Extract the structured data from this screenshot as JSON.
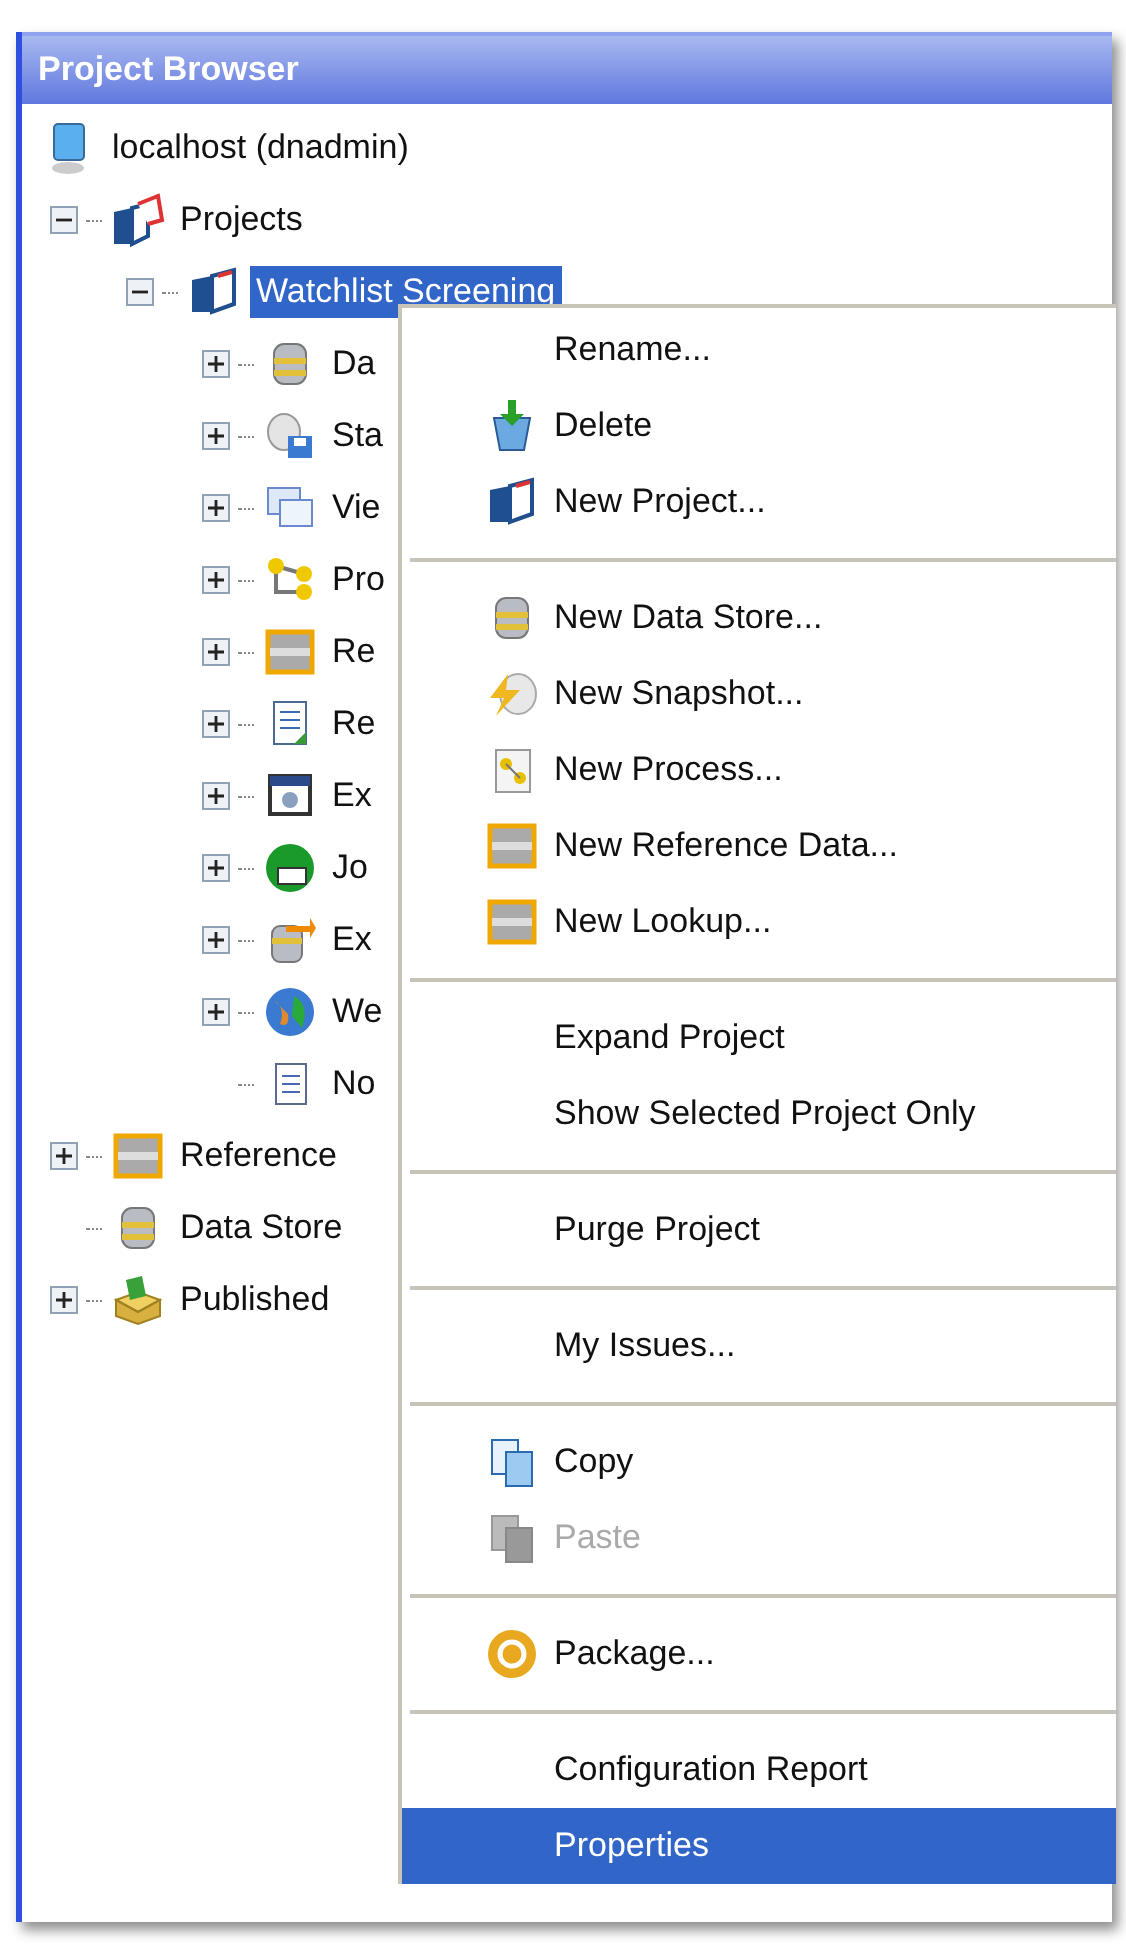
{
  "panel": {
    "title": "Project Browser"
  },
  "host": {
    "label": "localhost (dnadmin)"
  },
  "tree": [
    {
      "label": "Projects",
      "expanded": true,
      "selected": false,
      "children": [
        {
          "label": "Watchlist Screening",
          "expanded": true,
          "selected": true,
          "children": [
            {
              "label": "Da",
              "expanded": false,
              "selected": false
            },
            {
              "label": "Sta",
              "expanded": false,
              "selected": false
            },
            {
              "label": "Vie",
              "expanded": false,
              "selected": false
            },
            {
              "label": "Pro",
              "expanded": false,
              "selected": false
            },
            {
              "label": "Re",
              "expanded": false,
              "selected": false
            },
            {
              "label": "Re",
              "expanded": false,
              "selected": false
            },
            {
              "label": "Ex",
              "expanded": false,
              "selected": false
            },
            {
              "label": "Jo",
              "expanded": false,
              "selected": false
            },
            {
              "label": "Ex",
              "expanded": false,
              "selected": false
            },
            {
              "label": "We",
              "expanded": false,
              "selected": false
            },
            {
              "label": "No",
              "selected": false
            }
          ]
        }
      ]
    },
    {
      "label": "Reference",
      "expanded": false,
      "selected": false
    },
    {
      "label": "Data Store",
      "selected": false
    },
    {
      "label": "Published",
      "expanded": false,
      "selected": false
    }
  ],
  "menu": {
    "groups": [
      [
        {
          "label": "Rename...",
          "selected": false,
          "disabled": false
        },
        {
          "label": "Delete",
          "selected": false,
          "disabled": false
        },
        {
          "label": "New Project...",
          "selected": false,
          "disabled": false
        }
      ],
      [
        {
          "label": "New Data Store...",
          "selected": false,
          "disabled": false
        },
        {
          "label": "New Snapshot...",
          "selected": false,
          "disabled": false
        },
        {
          "label": "New Process...",
          "selected": false,
          "disabled": false
        },
        {
          "label": "New Reference Data...",
          "selected": false,
          "disabled": false
        },
        {
          "label": "New Lookup...",
          "selected": false,
          "disabled": false
        }
      ],
      [
        {
          "label": "Expand Project",
          "selected": false,
          "disabled": false
        },
        {
          "label": "Show Selected Project Only",
          "selected": false,
          "disabled": false
        }
      ],
      [
        {
          "label": "Purge Project",
          "selected": false,
          "disabled": false
        }
      ],
      [
        {
          "label": "My Issues...",
          "selected": false,
          "disabled": false
        }
      ],
      [
        {
          "label": "Copy",
          "selected": false,
          "disabled": false
        },
        {
          "label": "Paste",
          "selected": false,
          "disabled": true
        }
      ],
      [
        {
          "label": "Package...",
          "selected": false,
          "disabled": false
        }
      ],
      [
        {
          "label": "Configuration Report",
          "selected": false,
          "disabled": false
        },
        {
          "label": "Properties",
          "selected": true,
          "disabled": false
        }
      ]
    ]
  }
}
